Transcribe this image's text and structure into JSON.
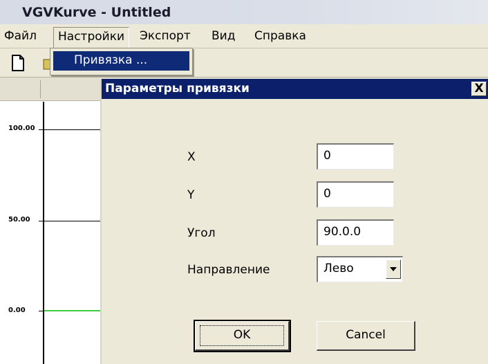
{
  "window": {
    "title": "VGVKurve - Untitled"
  },
  "menubar": {
    "items": [
      "Файл",
      "Настройки",
      "Экспорт",
      "Вид",
      "Справка"
    ],
    "open_menu": {
      "items": [
        "Привязка ..."
      ]
    }
  },
  "toolbar": {
    "icons": [
      "new-file-icon",
      "open-folder-icon"
    ]
  },
  "chart": {
    "y_ticks": [
      "100.00",
      "50.00",
      "0.00"
    ],
    "line_color": "#3ec93e"
  },
  "dialog": {
    "title": "Параметры привязки",
    "close_label": "X",
    "fields": [
      {
        "label": "X",
        "value": "0"
      },
      {
        "label": "Y",
        "value": "0"
      },
      {
        "label": "Угол",
        "value": "90.0.0"
      }
    ],
    "direction": {
      "label": "Направление",
      "value": "Лево"
    },
    "ok_label": "OK",
    "cancel_label": "Cancel"
  },
  "colors": {
    "dialog_title_bg": "#0c1f6b",
    "menu_highlight": "#0f2a77",
    "chrome": "#ece9d8"
  }
}
